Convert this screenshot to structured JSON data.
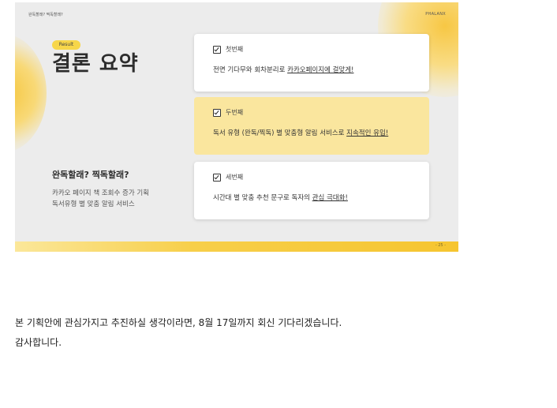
{
  "slide": {
    "top_left": "완독할래? 찍독할래?",
    "top_right": "PHALANX",
    "badge": "Result",
    "title": "결론 요약",
    "subtitle": "완독할래? 찍독할래?",
    "desc_line1": "카카오 페이지 책 조회수 증가 기획",
    "desc_line2": "독서유형 별 맞춤 알림 서비스",
    "page_number": "- 25 -",
    "cards": [
      {
        "label": "첫번째",
        "text": "전면 기다무와 회차분리로 ",
        "highlight": "카카오페이지에 걸맞게!"
      },
      {
        "label": "두번째",
        "text": "독서 유형 (완독/찍독) 별 맞춤형 알림 서비스로 ",
        "highlight": "지속적인 유입!"
      },
      {
        "label": "세번째",
        "text": "시간대 별 맞춤 추천 문구로 독자의 ",
        "highlight": "관심 극대화!"
      }
    ]
  },
  "message": {
    "line1": "본 기획안에 관심가지고 추진하실 생각이라면, 8월 17일까지 회신 기다리겠습니다.",
    "line2": "감사합니다."
  },
  "colors": {
    "accent_yellow": "#f7d64a",
    "card_yellow": "#fae69e",
    "slide_bg": "#ececec"
  }
}
